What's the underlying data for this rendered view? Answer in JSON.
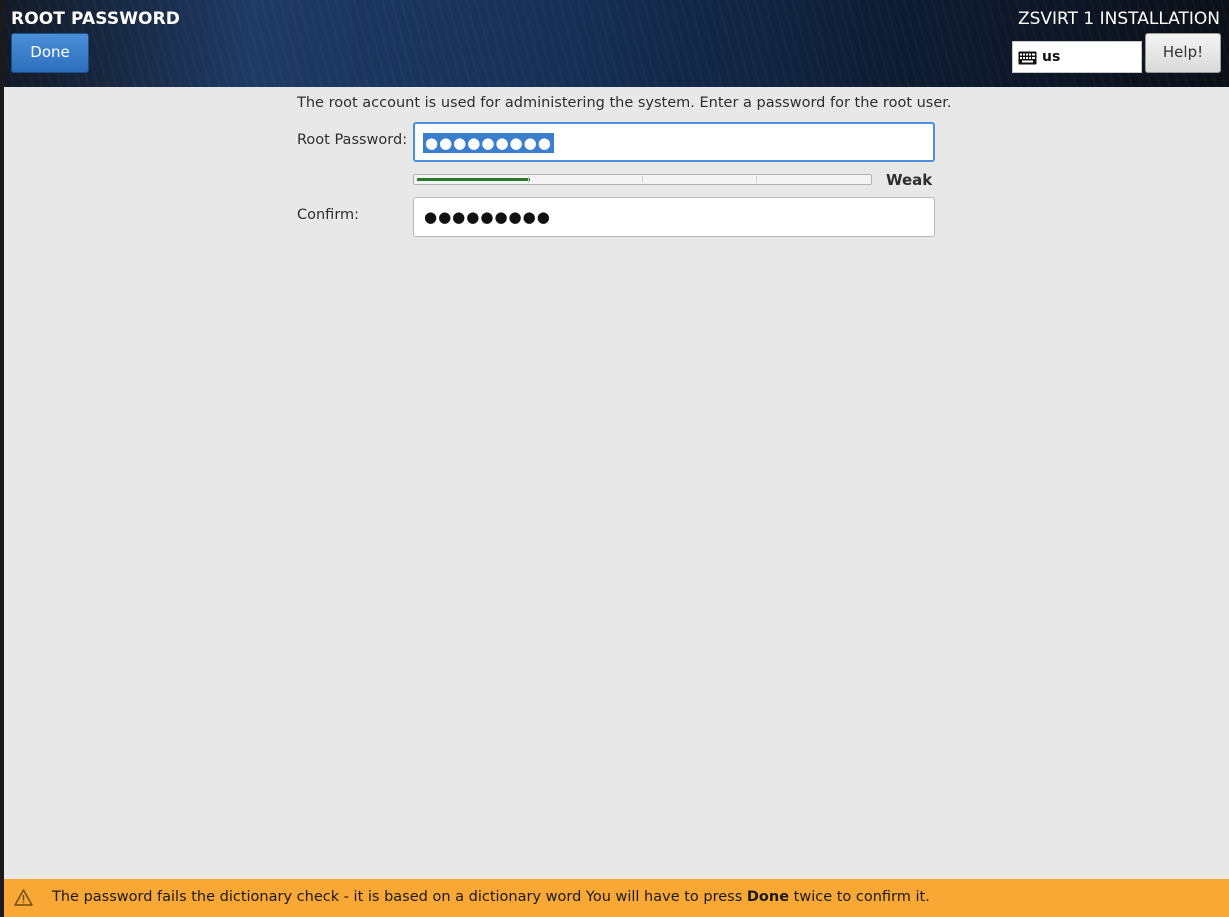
{
  "header": {
    "spoke_title": "ROOT PASSWORD",
    "done_label": "Done",
    "product_title": "ZSVIRT 1 INSTALLATION",
    "keyboard_layout": "us",
    "keyboard_icon": "keyboard-icon",
    "help_label": "Help!"
  },
  "form": {
    "intro": "The root account is used for administering the system.  Enter a password for the root user.",
    "root_password_label": "Root Password:",
    "root_password_value": "●●●●●●●●●",
    "strength_label": "Weak",
    "strength_fraction": 0.25,
    "confirm_label": "Confirm:",
    "confirm_value": "●●●●●●●●●"
  },
  "warning": {
    "icon": "warning-icon",
    "text_before": "The password fails the dictionary check - it is based on a dictionary word You will have to press ",
    "text_bold": "Done",
    "text_after": " twice to confirm it.",
    "color": "#f9a835"
  }
}
